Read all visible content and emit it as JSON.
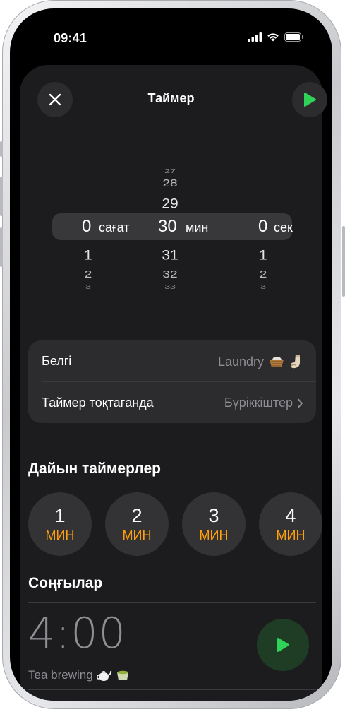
{
  "status_bar": {
    "time": "09:41"
  },
  "header": {
    "title": "Таймер"
  },
  "picker": {
    "hours": {
      "selected": "0",
      "unit": "сағат",
      "below": [
        "1",
        "2",
        "3"
      ]
    },
    "minutes": {
      "above": [
        "27",
        "28",
        "29"
      ],
      "selected": "30",
      "unit": "мин",
      "below": [
        "31",
        "32",
        "33"
      ]
    },
    "seconds": {
      "selected": "0",
      "unit": "сек",
      "below": [
        "1",
        "2",
        "3"
      ]
    }
  },
  "settings": {
    "label_row": {
      "label": "Белгі",
      "value": "Laundry"
    },
    "end_row": {
      "label": "Таймер тоқтағанда",
      "value": "Бүріккіштер"
    }
  },
  "presets": {
    "title": "Дайын таймерлер",
    "items": [
      {
        "value": "1",
        "unit": "МИН"
      },
      {
        "value": "2",
        "unit": "МИН"
      },
      {
        "value": "3",
        "unit": "МИН"
      },
      {
        "value": "4",
        "unit": "МИН"
      }
    ]
  },
  "recents": {
    "title": "Соңғылар",
    "items": [
      {
        "time": "4:00",
        "label": "Tea brewing"
      }
    ]
  },
  "colors": {
    "accent_green": "#30d158",
    "accent_orange": "#ff9f0a",
    "sheet": "#1c1c1e",
    "card": "#2c2c2e"
  },
  "icons": [
    "close-icon",
    "play-icon",
    "chevron-right-icon",
    "basket-emoji-icon",
    "sock-emoji-icon",
    "teapot-emoji-icon",
    "tea-cup-emoji-icon",
    "signal-icon",
    "wifi-icon",
    "battery-icon"
  ]
}
